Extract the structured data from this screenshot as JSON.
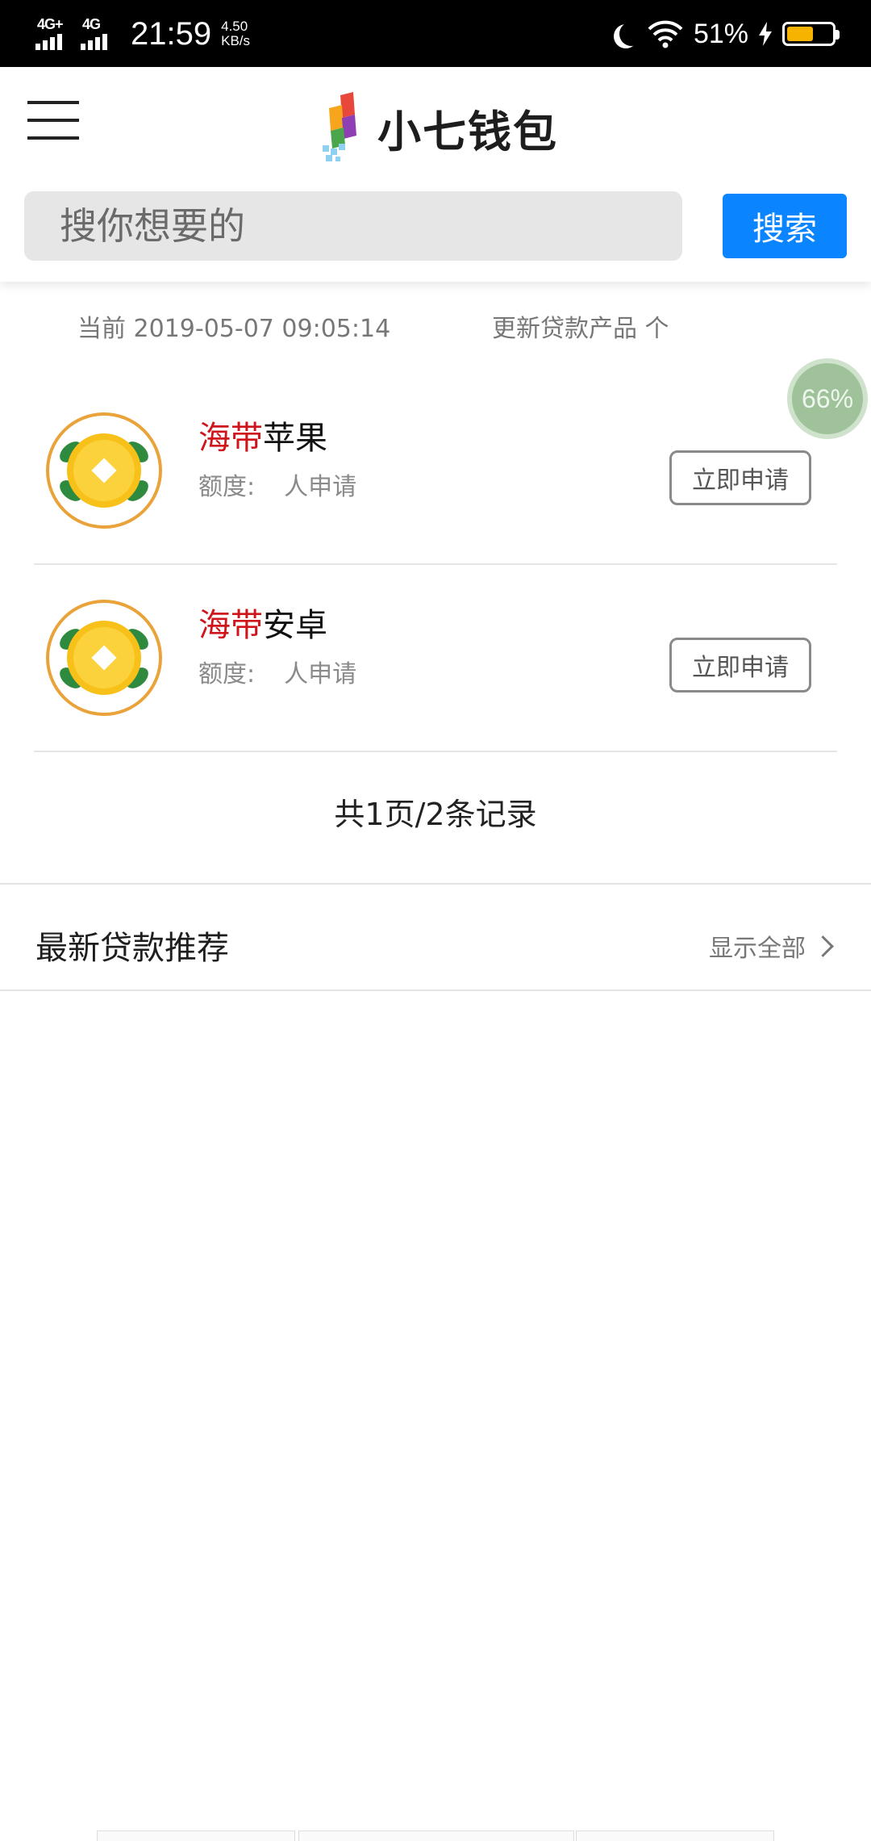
{
  "status_bar": {
    "network1": "4G+",
    "network2": "4G",
    "time": "21:59",
    "speed_value": "4.50",
    "speed_unit": "KB/s",
    "battery_percent": "51%",
    "battery_color": "#f6b400"
  },
  "header": {
    "app_name": "小七钱包",
    "search_placeholder": "搜你想要的",
    "search_button": "搜索",
    "search_button_color": "#0a84ff"
  },
  "info": {
    "current_time": "当前 2019-05-07 09:05:14",
    "update_text": "更新贷款产品 个"
  },
  "float_progress": "66%",
  "products": [
    {
      "brand": "海带",
      "name": "苹果",
      "quota_label": "额度:",
      "quota_value": "人申请",
      "apply_label": "立即申请"
    },
    {
      "brand": "海带",
      "name": "安卓",
      "quota_label": "额度:",
      "quota_value": "人申请",
      "apply_label": "立即申请"
    }
  ],
  "pagination": "共1页/2条记录",
  "recommend": {
    "title": "最新贷款推荐",
    "show_all": "显示全部"
  },
  "colors": {
    "brand_red": "#d0141b",
    "coin_gold": "#f7c11a",
    "leaf_green": "#2e8a3e"
  }
}
